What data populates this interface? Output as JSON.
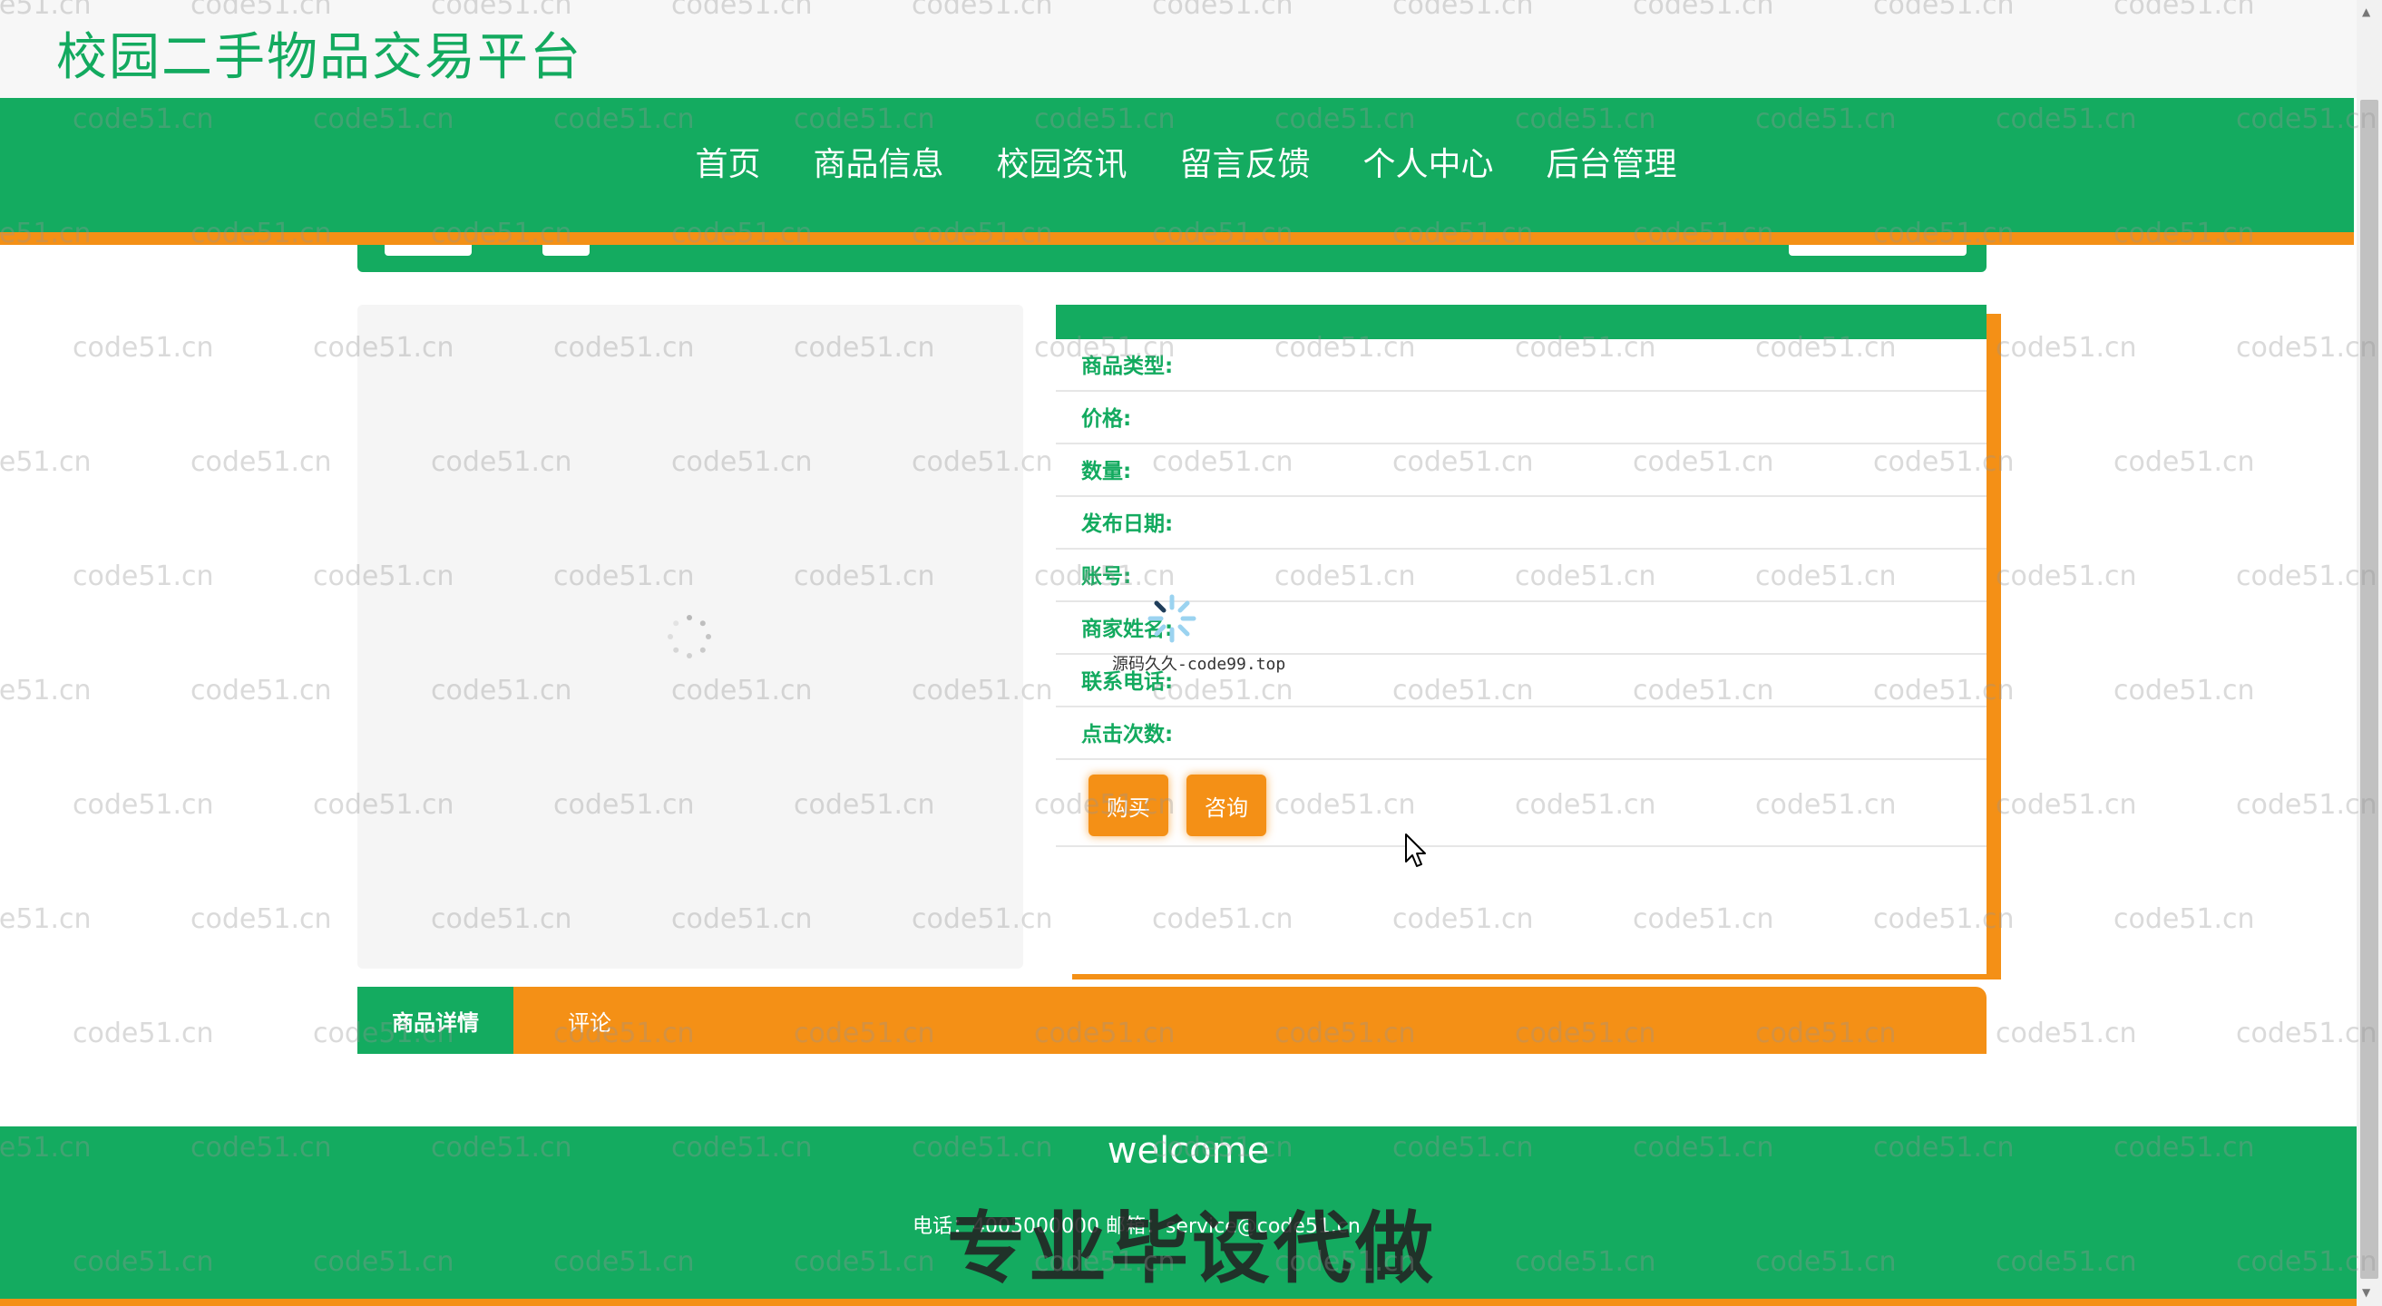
{
  "header": {
    "site_title": "校园二手物品交易平台"
  },
  "nav": {
    "items": [
      {
        "label": "首页"
      },
      {
        "label": "商品信息"
      },
      {
        "label": "校园资讯"
      },
      {
        "label": "留言反馈"
      },
      {
        "label": "个人中心"
      },
      {
        "label": "后台管理"
      }
    ]
  },
  "product_info": {
    "fields": [
      {
        "label": "商品类型:",
        "value": ""
      },
      {
        "label": "价格:",
        "value": ""
      },
      {
        "label": "数量:",
        "value": ""
      },
      {
        "label": "发布日期:",
        "value": ""
      },
      {
        "label": "账号:",
        "value": ""
      },
      {
        "label": "商家姓名:",
        "value": ""
      },
      {
        "label": "联系电话:",
        "value": ""
      },
      {
        "label": "点击次数:",
        "value": ""
      }
    ],
    "buy_label": "购买",
    "consult_label": "咨询"
  },
  "tabs": {
    "details_label": "商品详情",
    "comment_label": "评论"
  },
  "footer": {
    "welcome": "welcome",
    "contact": "电话：4005000000  邮箱：service@code51.cn",
    "promo": "专业毕设代做"
  },
  "overlay": {
    "source_text": "源码久久-code99.top"
  },
  "watermark_text": "code51.cn",
  "colors": {
    "primary": "#14ab60",
    "accent": "#f49016",
    "title_green": "#13aa5f"
  },
  "icons": {
    "loading": "loading-spinner-icon",
    "cursor": "mouse-pointer-icon"
  }
}
